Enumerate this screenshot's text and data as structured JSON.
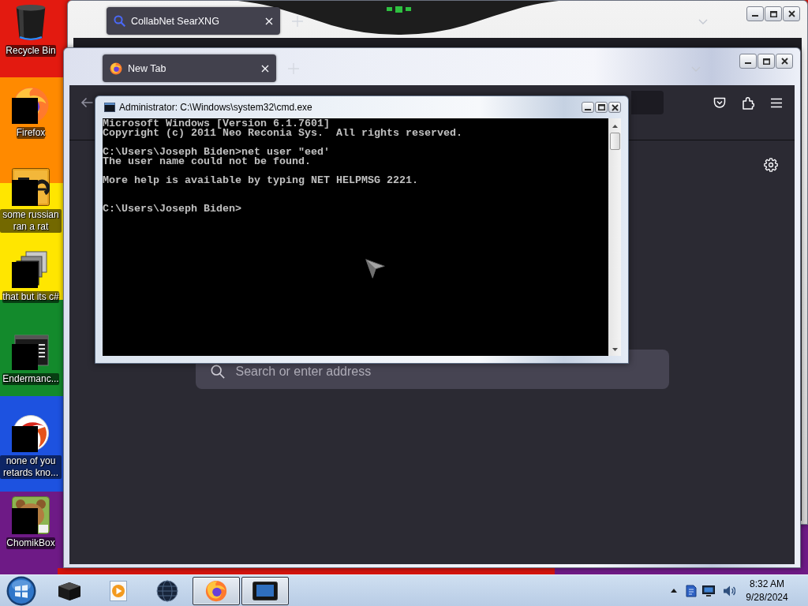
{
  "desktop": {
    "icons": [
      {
        "label": "Recycle Bin",
        "kind": "recycle_bin",
        "redacted": false
      },
      {
        "label": "Firefox",
        "kind": "firefox",
        "redacted": true
      },
      {
        "label": "some russian ran a rat",
        "kind": "letter_tile",
        "redacted": true
      },
      {
        "label": "that but its c#",
        "kind": "stacked_windows",
        "redacted": true
      },
      {
        "label": "Endermanc...",
        "kind": "terminal",
        "redacted": true
      },
      {
        "label": "none of you retards kno...",
        "kind": "swirl",
        "redacted": true
      },
      {
        "label": "ChomikBox",
        "kind": "animal_tile",
        "redacted": true
      }
    ]
  },
  "windows": [
    {
      "kind": "browser",
      "tabs": [
        {
          "title": "CollabNet SearXNG",
          "kind": "search",
          "selected": true
        }
      ]
    },
    {
      "kind": "browser",
      "tabs": [
        {
          "title": "New Tab",
          "kind": "firefox",
          "selected": true
        }
      ],
      "new_tab_page": {
        "search": {
          "placeholder": "Search or enter address"
        }
      }
    },
    {
      "kind": "console",
      "title": "Administrator: C:\\Windows\\system32\\cmd.exe",
      "lines": [
        {
          "kind": "text",
          "text": "Microsoft Windows [Version 6.1.7601]"
        },
        {
          "kind": "text",
          "text": "Copyright (c) 2011 Neo Reconia Sys.  All rights reserved."
        },
        {
          "kind": "blank"
        },
        {
          "kind": "text",
          "text": "C:\\Users\\Joseph Biden>net user \"eed'"
        },
        {
          "kind": "text",
          "text": "The user name could not be found."
        },
        {
          "kind": "blank"
        },
        {
          "kind": "text",
          "text": "More help is available by typing NET HELPMSG 2221."
        },
        {
          "kind": "blank"
        },
        {
          "kind": "blank"
        },
        {
          "kind": "text",
          "text": "C:\\Users\\Joseph Biden>"
        }
      ]
    }
  ],
  "taskbar": {
    "items": [
      {
        "kind": "cube",
        "active": false
      },
      {
        "kind": "media_player",
        "active": false
      },
      {
        "kind": "globe",
        "active": false
      },
      {
        "kind": "firefox",
        "active": true
      },
      {
        "kind": "console",
        "active": true
      }
    ],
    "clock": {
      "time": "8:32 AM",
      "date": "9/28/2024"
    }
  }
}
